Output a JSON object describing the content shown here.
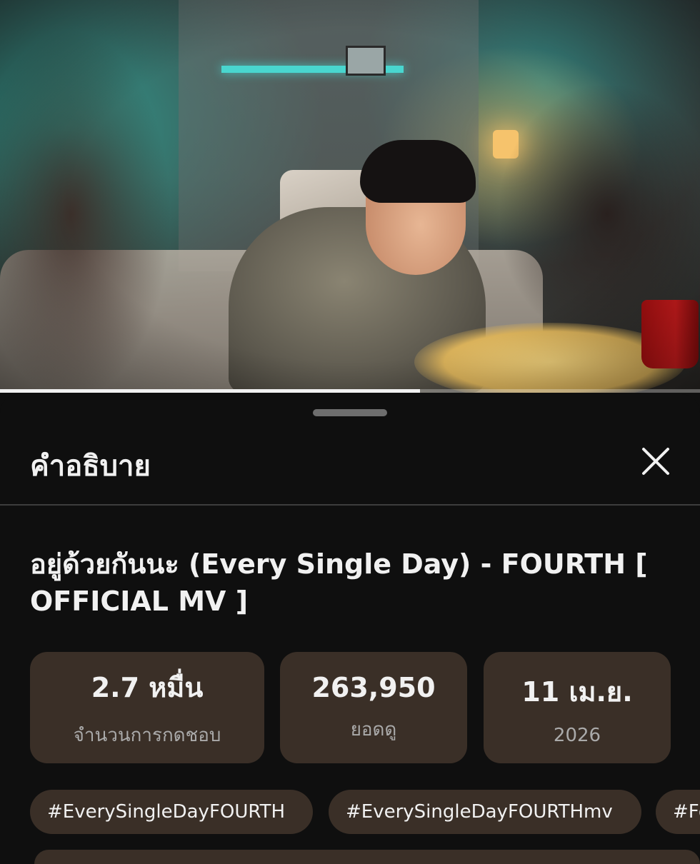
{
  "video": {
    "progress_fraction": 0.6
  },
  "sheet": {
    "title": "คำอธิบาย",
    "close_icon": "close-icon"
  },
  "video_title": "อยู่ด้วยกันนะ (Every Single Day) - FOURTH [ OFFICIAL MV ]",
  "stats": {
    "likes": {
      "value": "2.7 หมื่น",
      "label": "จำนวนการกดชอบ"
    },
    "views": {
      "value": "263,950",
      "label": "ยอดดู"
    },
    "date": {
      "value": "11 เม.ย.",
      "label": "2026"
    }
  },
  "hashtags": [
    "#EverySingleDayFOURTH",
    "#EverySingleDayFOURTHmv",
    "#Fo"
  ],
  "colors": {
    "background": "#0f0f0f",
    "chip": "#3a2f27",
    "text_primary": "#f1f1f1",
    "text_secondary": "#aaaaaa"
  }
}
